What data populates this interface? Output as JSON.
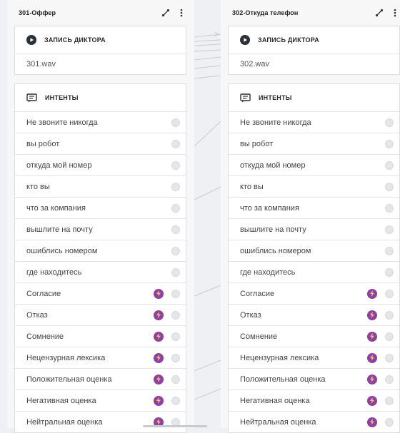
{
  "nodes": [
    {
      "title": "301-Оффер",
      "record_label": "ЗАПИСЬ ДИКТОРА",
      "audio_file": "301.wav",
      "intents_label": "ИНТЕНТЫ",
      "intents": [
        {
          "label": "Не звоните никогда",
          "bolt": false
        },
        {
          "label": "вы робот",
          "bolt": false
        },
        {
          "label": "откуда мой номер",
          "bolt": false
        },
        {
          "label": "кто вы",
          "bolt": false
        },
        {
          "label": "что за компания",
          "bolt": false
        },
        {
          "label": "вышлите на почту",
          "bolt": false
        },
        {
          "label": "ошиблись номером",
          "bolt": false
        },
        {
          "label": "где находитесь",
          "bolt": false
        },
        {
          "label": "Согласие",
          "bolt": true
        },
        {
          "label": "Отказ",
          "bolt": true
        },
        {
          "label": "Сомнение",
          "bolt": true
        },
        {
          "label": "Нецензурная лексика",
          "bolt": true
        },
        {
          "label": "Положительная оценка",
          "bolt": true
        },
        {
          "label": "Негативная оценка",
          "bolt": true
        },
        {
          "label": "Нейтральная оценка",
          "bolt": true
        }
      ]
    },
    {
      "title": "302-Откуда телефон",
      "record_label": "ЗАПИСЬ ДИКТОРА",
      "audio_file": "302.wav",
      "intents_label": "ИНТЕНТЫ",
      "intents": [
        {
          "label": "Не звоните никогда",
          "bolt": false
        },
        {
          "label": "вы робот",
          "bolt": false
        },
        {
          "label": "откуда мой номер",
          "bolt": false
        },
        {
          "label": "кто вы",
          "bolt": false
        },
        {
          "label": "что за компания",
          "bolt": false
        },
        {
          "label": "вышлите на почту",
          "bolt": false
        },
        {
          "label": "ошиблись номером",
          "bolt": false
        },
        {
          "label": "где находитесь",
          "bolt": false
        },
        {
          "label": "Согласие",
          "bolt": true
        },
        {
          "label": "Отказ",
          "bolt": true
        },
        {
          "label": "Сомнение",
          "bolt": true
        },
        {
          "label": "Нецензурная лексика",
          "bolt": true
        },
        {
          "label": "Положительная оценка",
          "bolt": true
        },
        {
          "label": "Негативная оценка",
          "bolt": true
        },
        {
          "label": "Нейтральная оценка",
          "bolt": true
        }
      ]
    }
  ],
  "colors": {
    "bolt": "#8f3fa8",
    "canvas": "#eef0f3",
    "card_border": "#dcdde2",
    "connector": "#c8ccd2"
  }
}
